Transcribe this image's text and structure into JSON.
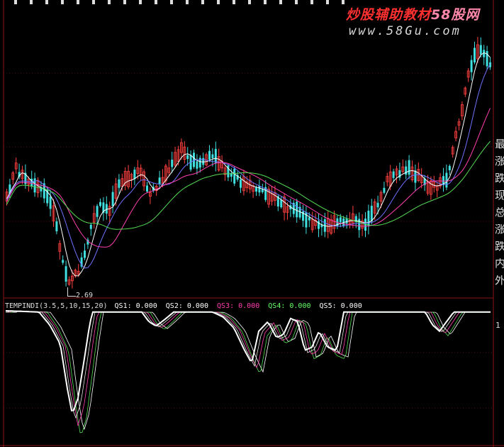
{
  "watermark": {
    "title_part1": "炒股辅助教材",
    "title_part2": "58股网",
    "url": "www.58Gu.com"
  },
  "main_chart": {
    "low_label": "2.69",
    "right_axis_text": [
      "最",
      "涨",
      "跌",
      "现",
      "总",
      "涨",
      "跌",
      "内",
      "外"
    ]
  },
  "indicator": {
    "name": "TEMPINDI(3.5,5,10,15,20)",
    "series": [
      {
        "name": "QS1",
        "value": "0.000",
        "color": "#ffffff"
      },
      {
        "name": "QS2",
        "value": "0.000",
        "color": "#ffffff"
      },
      {
        "name": "QS3",
        "value": "0.000",
        "color": "#ff3fb0"
      },
      {
        "name": "QS4",
        "value": "0.000",
        "color": "#66ff66"
      },
      {
        "name": "QS5",
        "value": "0.000",
        "color": "#ffffff"
      }
    ],
    "scale_top": "1"
  },
  "colors": {
    "background": "#000000",
    "border": "#8b1414",
    "up_candle": "#ff4040",
    "down_candle": "#40e0e0",
    "ma_white": "#ffffff",
    "ma_purple": "#7070ff",
    "ma_magenta": "#ff3fb0",
    "ma_green": "#55dd55",
    "watermark_red": "#ff3030",
    "watermark_pink": "#ff88aa"
  }
}
